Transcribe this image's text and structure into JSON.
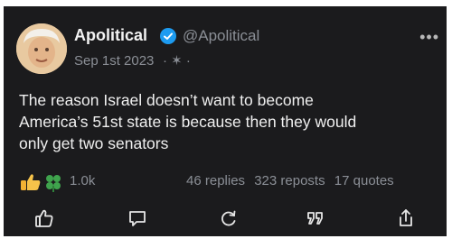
{
  "post": {
    "author_name": "Apolitical",
    "handle": "@Apolitical",
    "date": "Sep 1st 2023",
    "date_extra": "· ✶ ·",
    "more_menu": "•••",
    "text_lines": [
      "The reason Israel doesn’t want to become",
      "America’s 51st state is because then they would",
      "only get two senators"
    ],
    "likes": "1.0k",
    "replies": "46 replies",
    "reposts": "323 reposts",
    "quotes": "17 quotes"
  },
  "colors": {
    "card_bg": "#1b1b1d",
    "verified_blue": "#1d9bf0",
    "muted": "#8b8f96"
  },
  "icons": {
    "verified": "verified-badge-icon",
    "like": "thumbs-up-icon",
    "comment": "comment-icon",
    "repost": "repost-icon",
    "quote": "quote-icon",
    "share": "share-icon"
  }
}
